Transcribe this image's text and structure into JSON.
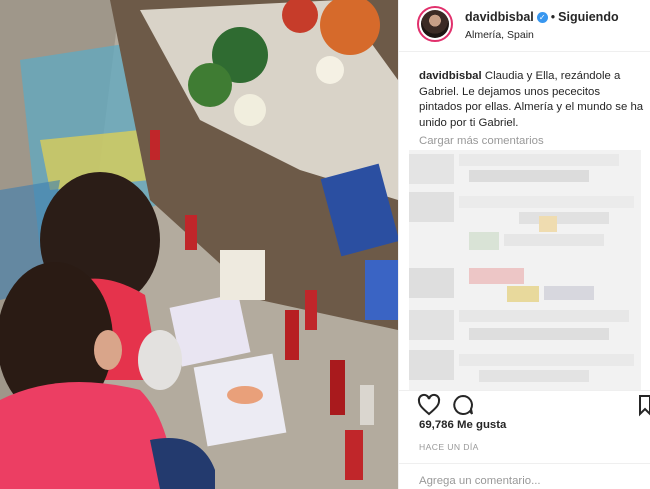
{
  "header": {
    "username": "davidbisbal",
    "verified_mark": "✓",
    "separator": "•",
    "follow_status": "Siguiendo",
    "location": "Almería, Spain"
  },
  "caption": {
    "username": "davidbisbal",
    "text": " Claudia y Ella, rezándole a Gabriel. Le dejamos unos pececitos pintados por ellas. Almería y el mundo se ha unido por ti Gabriel."
  },
  "comments": {
    "load_more": "Cargar más comentarios"
  },
  "actions": {
    "like_icon": "heart-icon",
    "comment_icon": "comment-icon",
    "save_icon": "bookmark-icon",
    "likes": "69,786 Me gusta",
    "timestamp": "HACE UN DÍA"
  },
  "add_comment": {
    "placeholder": "Agrega un comentario..."
  },
  "colors": {
    "verified": "#3897f0",
    "muted": "#999999",
    "border": "#efefef",
    "story_ring": "#e1306c"
  }
}
